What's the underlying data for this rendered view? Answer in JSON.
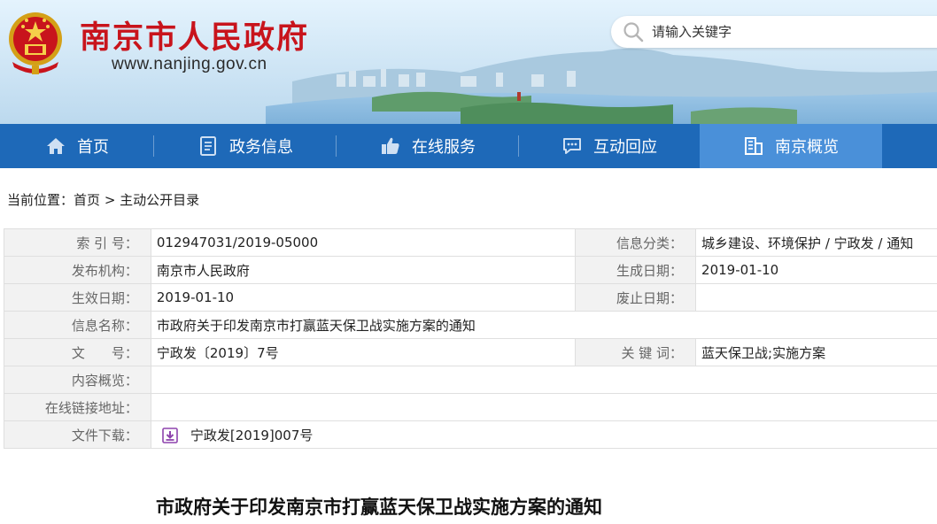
{
  "header": {
    "title": "南京市人民政府",
    "url": "www.nanjing.gov.cn",
    "search_placeholder": "请输入关键字"
  },
  "nav": {
    "items": [
      {
        "label": "首页",
        "icon": "home-icon"
      },
      {
        "label": "政务信息",
        "icon": "document-icon"
      },
      {
        "label": "在线服务",
        "icon": "thumbs-up-icon"
      },
      {
        "label": "互动回应",
        "icon": "chat-icon"
      },
      {
        "label": "南京概览",
        "icon": "building-icon",
        "active": true
      }
    ]
  },
  "breadcrumb": {
    "prefix": "当前位置：",
    "home": "首页",
    "separator": ">",
    "current": "主动公开目录"
  },
  "info": {
    "index_label": "索 引 号：",
    "index_value": "012947031/2019-05000",
    "category_label": "信息分类：",
    "category_value": "城乡建设、环境保护 / 宁政发 / 通知",
    "publisher_label": "发布机构：",
    "publisher_value": "南京市人民政府",
    "created_label": "生成日期：",
    "created_value": "2019-01-10",
    "effective_label": "生效日期：",
    "effective_value": "2019-01-10",
    "expire_label": "废止日期：",
    "expire_value": "",
    "name_label": "信息名称：",
    "name_value": "市政府关于印发南京市打赢蓝天保卫战实施方案的通知",
    "docno_label": "文　　号：",
    "docno_value": "宁政发〔2019〕7号",
    "keywords_label": "关 键 词：",
    "keywords_value": "蓝天保卫战;实施方案",
    "summary_label": "内容概览：",
    "summary_value": "",
    "link_label": "在线链接地址：",
    "link_value": "",
    "download_label": "文件下载：",
    "download_value": "宁政发[2019]007号"
  },
  "article": {
    "title": "市政府关于印发南京市打赢蓝天保卫战实施方案的通知"
  },
  "colors": {
    "title_red": "#c8141c",
    "nav_blue": "#1e69b8",
    "nav_active": "#4a90d9"
  }
}
